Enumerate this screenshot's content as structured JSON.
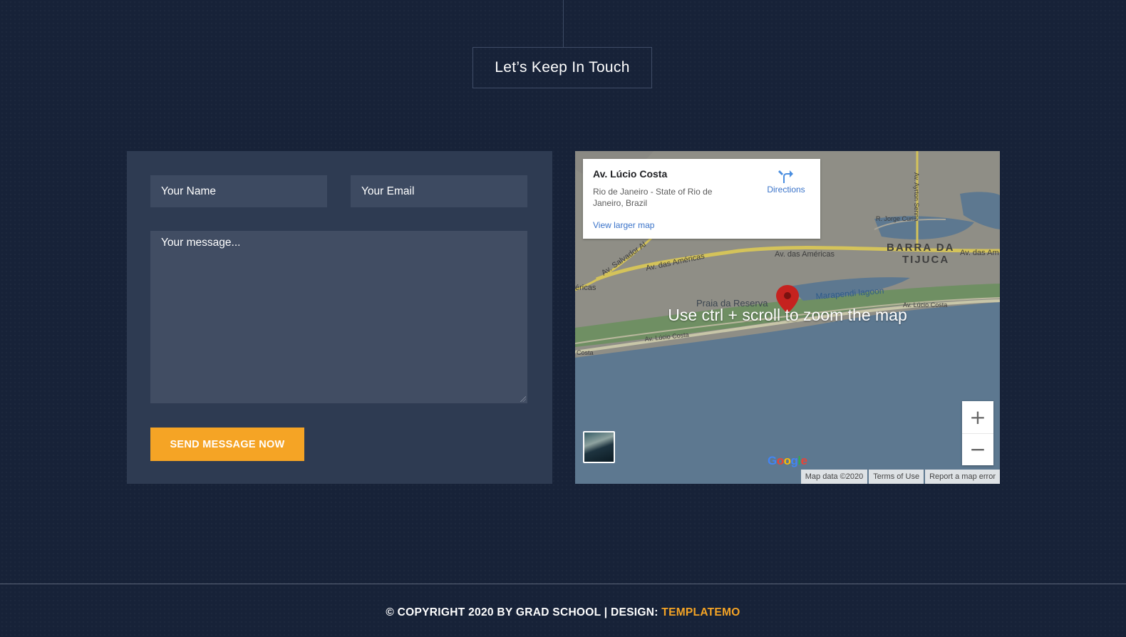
{
  "section": {
    "heading": "Let’s Keep In Touch"
  },
  "form": {
    "name_placeholder": "Your Name",
    "email_placeholder": "Your Email",
    "message_placeholder": "Your message...",
    "submit_label": "SEND MESSAGE NOW"
  },
  "map": {
    "place_title": "Av. Lúcio Costa",
    "place_address": "Rio de Janeiro - State of Rio de Janeiro, Brazil",
    "view_larger_label": "View larger map",
    "directions_label": "Directions",
    "overlay_hint": "Use ctrl + scroll to zoom the map",
    "zoom_in_label": "+",
    "zoom_out_label": "−",
    "labels": {
      "barra_line1": "BARRA DA",
      "barra_line2": "TIJUCA",
      "av_americas_1": "Av. das Américas",
      "av_americas_2": "Av. das Américas",
      "av_americas_3": "Av. das Am",
      "av_salvador": "Av. Salvador Al",
      "americas_left": "éricas",
      "praia": "Praia da Reserva",
      "marapendi": "Marapendi lagoon",
      "av_lucio_1": "Av. Lúcio Costa",
      "av_lucio_2": "Av. Lúcio Costa",
      "costa_left": "Costa",
      "jorge_curi": "R. Jorge Curi",
      "ayrton": "Av. Ayrton Senna"
    },
    "google_logo": [
      "G",
      "o",
      "o",
      "g",
      "l",
      "e"
    ],
    "attribution": {
      "map_data": "Map data ©2020",
      "terms": "Terms of Use",
      "report": "Report a map error"
    }
  },
  "footer": {
    "copyright": "© COPYRIGHT 2020 BY GRAD SCHOOL | DESIGN: ",
    "design_link": "TEMPLATEMO"
  },
  "colors": {
    "background": "#172238",
    "panel": "#2e3b52",
    "accent": "#f5a425",
    "map_water": "#5d7890",
    "map_land": "#8c8c83"
  }
}
